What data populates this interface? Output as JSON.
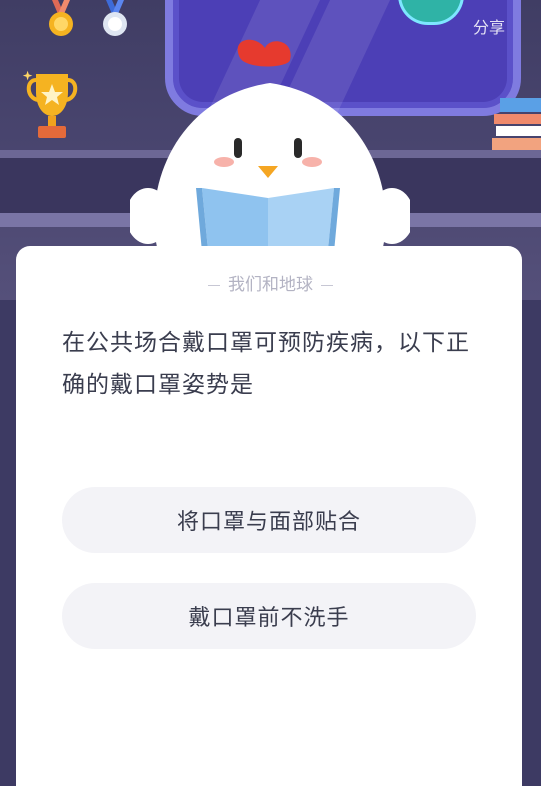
{
  "header": {
    "share_label": "分享"
  },
  "quiz": {
    "category": "我们和地球",
    "question": "在公共场合戴口罩可预防疾病，以下正确的戴口罩姿势是",
    "options": [
      {
        "label": "将口罩与面部贴合"
      },
      {
        "label": "戴口罩前不洗手"
      }
    ]
  },
  "colors": {
    "background": "#3d3a63",
    "card": "#ffffff",
    "option_bg": "#f3f3f7",
    "text": "#3a3d4e",
    "tag": "#b3b3c3"
  }
}
